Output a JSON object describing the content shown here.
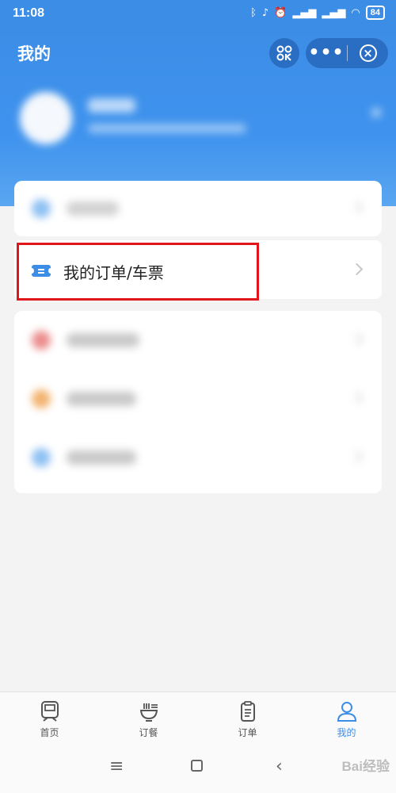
{
  "status_bar": {
    "time": "11:08",
    "battery": "84"
  },
  "header": {
    "title": "我的",
    "scan_button": "8 8\nO K",
    "more_label": "•••",
    "close_label": "×"
  },
  "menu": {
    "orders_label": "我的订单/车票"
  },
  "tabs": [
    {
      "label": "首页",
      "icon": "train-icon"
    },
    {
      "label": "订餐",
      "icon": "food-bowl-icon"
    },
    {
      "label": "订单",
      "icon": "clipboard-icon"
    },
    {
      "label": "我的",
      "icon": "person-icon",
      "active": true
    }
  ],
  "colors": {
    "accent": "#3c8de6",
    "highlight": "#e0161b"
  },
  "watermark": "Bai经验"
}
